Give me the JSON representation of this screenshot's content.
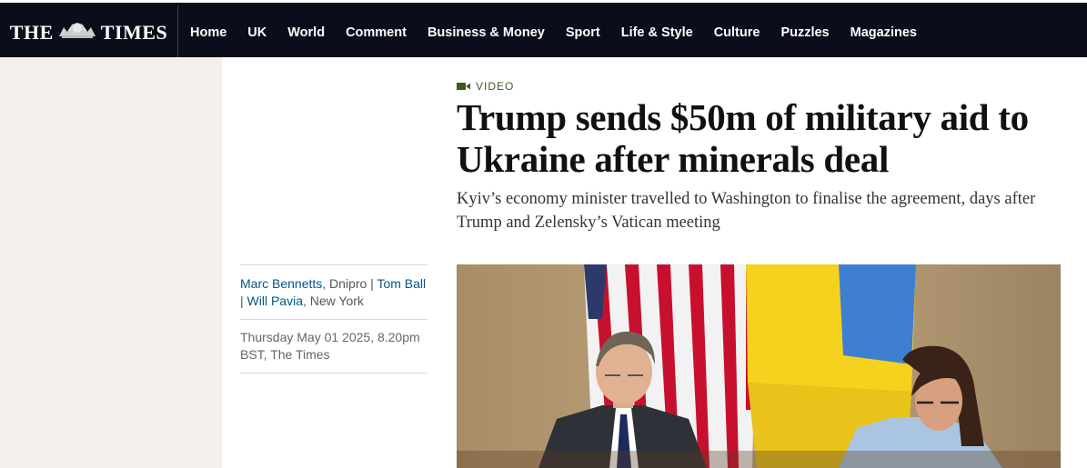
{
  "header": {
    "logo_left": "THE",
    "logo_right": "TIMES",
    "nav": [
      "Home",
      "UK",
      "World",
      "Comment",
      "Business & Money",
      "Sport",
      "Life & Style",
      "Culture",
      "Puzzles",
      "Magazines"
    ]
  },
  "article": {
    "label": "VIDEO",
    "headline": "Trump sends $50m of military aid to Ukraine after minerals deal",
    "standfirst": "Kyiv’s economy minister travelled to Washington to finalise the agreement, days after Trump and Zelensky’s Vatican meeting",
    "authors": [
      {
        "name": "Marc Bennetts",
        "location": ", Dnipro"
      },
      {
        "name": "Tom Ball",
        "location": ""
      },
      {
        "name": "Will Pavia",
        "location": ", New York"
      }
    ],
    "author_separator": " | ",
    "dateline": "Thursday May 01 2025, 8.20pm BST, The Times"
  },
  "colors": {
    "nav_bg": "#0b0d1a",
    "label_green": "#3d5a1f",
    "author_link": "#005689",
    "side_panel": "#f3efea"
  },
  "icons": [
    "video-camera-icon",
    "times-crest-icon"
  ]
}
